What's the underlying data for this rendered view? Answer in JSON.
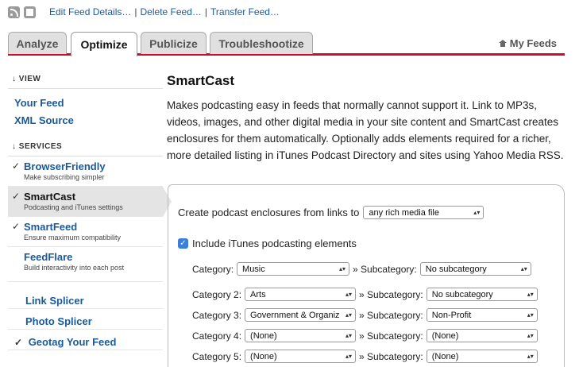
{
  "toolbar": {
    "rss_icon": "rss-icon",
    "doc_icon": "doc-icon",
    "links": [
      "Edit Feed Details…",
      "Delete Feed…",
      "Transfer Feed…"
    ],
    "separator": "|"
  },
  "tabs": [
    {
      "label": "Analyze"
    },
    {
      "label": "Optimize"
    },
    {
      "label": "Publicize"
    },
    {
      "label": "Troubleshootize"
    }
  ],
  "my_feeds": "My Feeds",
  "sidebar": {
    "view_heading": "↓ VIEW",
    "view_items": [
      "Your Feed",
      "XML Source"
    ],
    "services_heading": "↓ SERVICES",
    "services": [
      {
        "check": "✓",
        "name": "BrowserFriendly",
        "desc": "Make subscribing simpler"
      },
      {
        "check": "✓",
        "name": "SmartCast",
        "desc": "Podcasting and iTunes settings"
      },
      {
        "check": "✓",
        "name": "SmartFeed",
        "desc": "Ensure maximum compatibility"
      },
      {
        "check": "",
        "name": "FeedFlare",
        "desc": "Build interactivity into each post"
      }
    ],
    "plain_items": [
      {
        "check": "",
        "name": "Link Splicer"
      },
      {
        "check": "",
        "name": "Photo Splicer"
      },
      {
        "check": "✓",
        "name": "Geotag Your Feed"
      }
    ]
  },
  "main": {
    "title": "SmartCast",
    "description": "Makes podcasting easy in feeds that normally cannot support it. Link to MP3s, videos, images, and other digital media in your site content and SmartCast creates enclosures for them automatically. Optionally adds elements required for a richer, more detailed listing in iTunes Podcast Directory and sites using Yahoo Media RSS.",
    "enclosure_label": "Create podcast enclosures from links to",
    "enclosure_value": "any rich media file",
    "itunes_label": "Include iTunes podcasting elements",
    "itunes_checked": true,
    "subcategory_label": "» Subcategory:",
    "categories": [
      {
        "label": "Category:",
        "value": "Music",
        "sub": "No subcategory"
      },
      {
        "label": "Category 2:",
        "value": "Arts",
        "sub": "No subcategory"
      },
      {
        "label": "Category 3:",
        "value": "Government & Organiz",
        "sub": "Non-Profit"
      },
      {
        "label": "Category 4:",
        "value": "(None)",
        "sub": "(None)"
      },
      {
        "label": "Category 5:",
        "value": "(None)",
        "sub": "(None)"
      }
    ]
  },
  "colors": {
    "accent": "#c8102e",
    "link": "#1a5a9a"
  }
}
